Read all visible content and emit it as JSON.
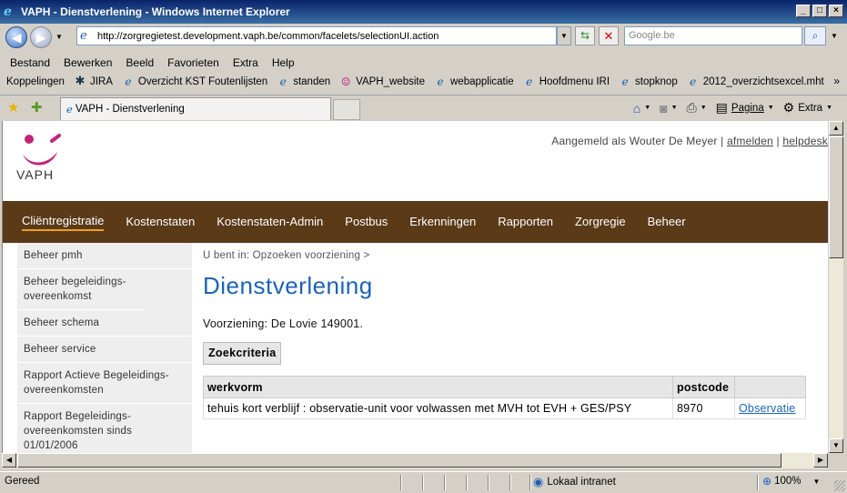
{
  "window": {
    "title": "VAPH - Dienstverlening - Windows Internet Explorer"
  },
  "address_bar": {
    "url": "http://zorgregietest.development.vaph.be/common/facelets/selectionUI.action",
    "search_placeholder": "Google.be"
  },
  "menu": [
    "Bestand",
    "Bewerken",
    "Beeld",
    "Favorieten",
    "Extra",
    "Help"
  ],
  "links_bar": {
    "label": "Koppelingen",
    "items": [
      {
        "label": "JIRA",
        "icon": "jira-icon"
      },
      {
        "label": "Overzicht KST Foutenlijsten",
        "icon": "ie-page-icon"
      },
      {
        "label": "standen",
        "icon": "ie-page-icon"
      },
      {
        "label": "VAPH_website",
        "icon": "vaph-icon"
      },
      {
        "label": "webapplicatie",
        "icon": "ie-page-icon"
      },
      {
        "label": "Hoofdmenu IRI",
        "icon": "ie-page-icon"
      },
      {
        "label": "stopknop",
        "icon": "ie-page-icon"
      },
      {
        "label": "2012_overzichtsexcel.mht",
        "icon": "ie-page-icon"
      }
    ]
  },
  "tabs": [
    {
      "label": "VAPH - Dienstverlening"
    }
  ],
  "command_bar": {
    "page_label": "Pagina",
    "tools_label": "Extra"
  },
  "page": {
    "logo_text": "VAPH",
    "user": {
      "prefix": "Aangemeld als Wouter De Meyer |",
      "logout": "afmelden",
      "separator": "|",
      "help": "helpdesk"
    },
    "nav": [
      {
        "label": "Cliëntregistratie",
        "active": true
      },
      {
        "label": "Kostenstaten"
      },
      {
        "label": "Kostenstaten-Admin"
      },
      {
        "label": "Postbus"
      },
      {
        "label": "Erkenningen"
      },
      {
        "label": "Rapporten"
      },
      {
        "label": "Zorgregie"
      },
      {
        "label": "Beheer"
      }
    ],
    "sidebar": [
      {
        "label": "Beheer pmh"
      },
      {
        "label": "Beheer begeleidings-overeenkomst"
      },
      {
        "label": "Beheer schema"
      },
      {
        "label": "Beheer service"
      },
      {
        "label": "Rapport Actieve Begeleidings-overeenkomsten"
      },
      {
        "label": "Rapport Begeleidings-overeenkomsten sinds 01/01/2006"
      }
    ],
    "breadcrumb": "U bent in: Opzoeken voorziening >",
    "title": "Dienstverlening",
    "voorziening": "Voorziening: De Lovie 149001.",
    "zoekcriteria": "Zoekcriteria",
    "table": {
      "headers": [
        "werkvorm",
        "postcode",
        ""
      ],
      "rows": [
        {
          "werkvorm": "tehuis kort verblijf : observatie-unit voor volwassen met MVH tot EVH + GES/PSY",
          "postcode": "8970",
          "action": "Observatie"
        }
      ]
    }
  },
  "status_bar": {
    "status": "Gereed",
    "zone": "Lokaal intranet",
    "zoom": "100%"
  },
  "colors": {
    "nav_bg": "#5a3a17",
    "title_blue": "#1c63b5",
    "brand_magenta": "#c0267a",
    "active_underline": "#f0a020"
  }
}
